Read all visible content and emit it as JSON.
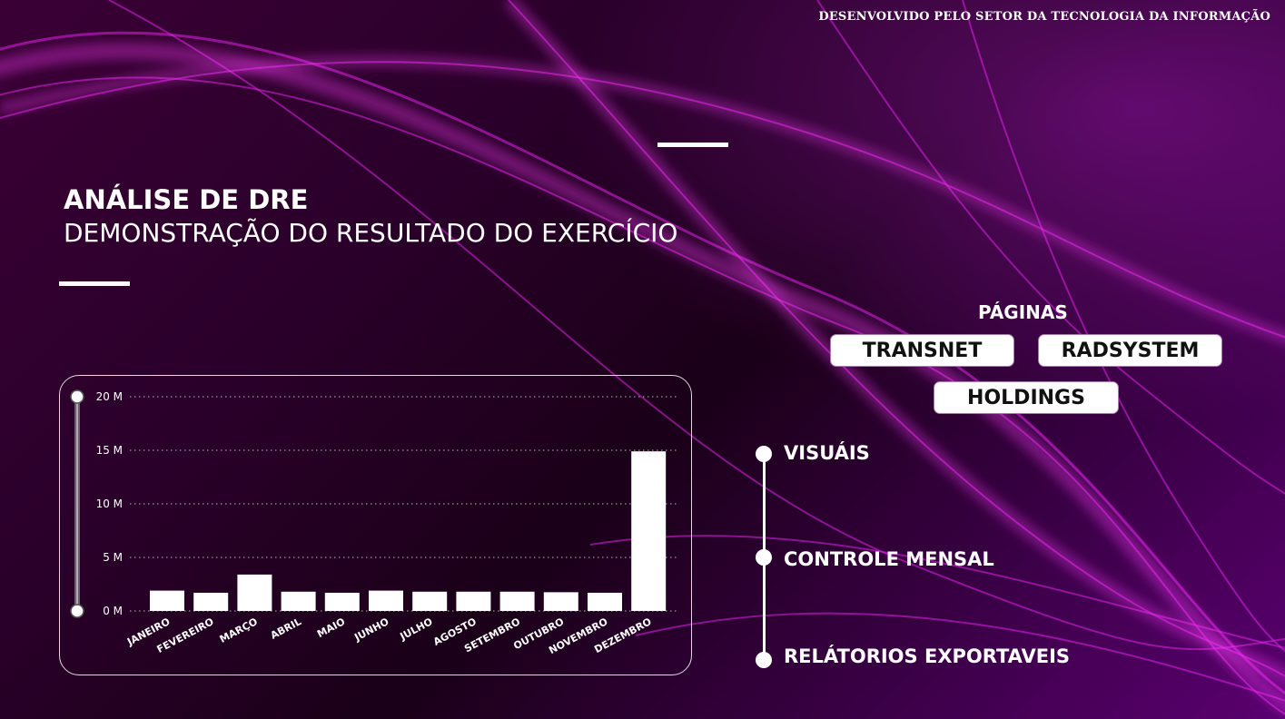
{
  "header": {
    "credit": "DESENVOLVIDO PELO SETOR DA TECNOLOGIA DA INFORMAÇÃO"
  },
  "title": {
    "main": "ANÁLISE DE DRE",
    "subtitle": "DEMONSTRAÇÃO DO RESULTADO DO EXERCÍCIO"
  },
  "pages": {
    "label": "PÁGINAS",
    "buttons": [
      "TRANSNET",
      "RADSYSTEM",
      "HOLDINGS"
    ]
  },
  "nav": {
    "items": [
      "VISUÁIS",
      "CONTROLE MENSAL",
      "RELÁTORIOS EXPORTAVEIS"
    ]
  },
  "colors": {
    "accent": "#ff00ff",
    "bar": "#ffffff",
    "background_dark": "#1a0018"
  },
  "chart_data": {
    "type": "bar",
    "categories": [
      "JANEIRO",
      "FEVEREIRO",
      "MARÇO",
      "ABRIL",
      "MAIO",
      "JUNHO",
      "JULHO",
      "AGOSTO",
      "SETEMBRO",
      "OUTUBRO",
      "NOVEMBRO",
      "DEZEMBRO"
    ],
    "values": [
      1.9,
      1.7,
      3.4,
      1.8,
      1.7,
      1.9,
      1.8,
      1.8,
      1.8,
      1.75,
      1.7,
      14.9
    ],
    "ylim": [
      0,
      20
    ],
    "yticks": [
      0,
      5,
      10,
      15,
      20
    ],
    "ytick_labels": [
      "0 M",
      "5 M",
      "10 M",
      "15 M",
      "20 M"
    ],
    "grid": true,
    "slider_range": [
      0,
      20
    ]
  }
}
